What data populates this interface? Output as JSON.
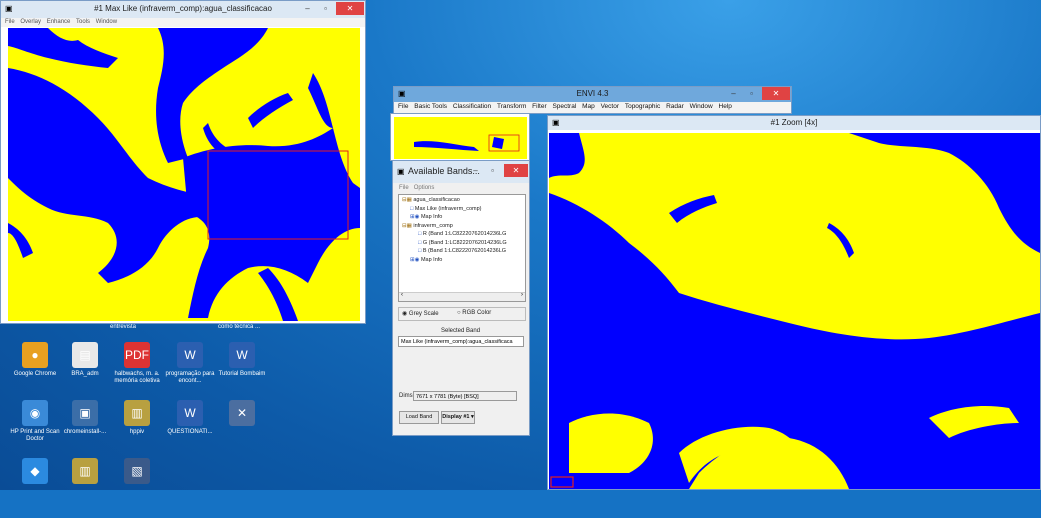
{
  "desktop": {
    "icons": [
      {
        "name": "chrome",
        "label": "Google Chrome",
        "color": "#e8a020",
        "glyph": "●"
      },
      {
        "name": "bra-adm",
        "label": "BRA_adm",
        "color": "#e8e8e8",
        "glyph": "▤"
      },
      {
        "name": "halbwachs",
        "label": "halbwachs, m. a. memória coletiva",
        "color": "#d33",
        "glyph": "PDF"
      },
      {
        "name": "programacao",
        "label": "programação para encont...",
        "color": "#2b5fb0",
        "glyph": "W"
      },
      {
        "name": "tutorial",
        "label": "Tutorial Bombaim",
        "color": "#2b5fb0",
        "glyph": "W"
      },
      {
        "name": "hp-print",
        "label": "HP Print and Scan Doctor",
        "color": "#3a8ad8",
        "glyph": "◉"
      },
      {
        "name": "chromeinstall",
        "label": "chromeinstall-...",
        "color": "#3b6ea8",
        "glyph": "▣"
      },
      {
        "name": "hppiv",
        "label": "hppiv",
        "color": "#b8a040",
        "glyph": "▥"
      },
      {
        "name": "questionati",
        "label": "QUESTIONATI...",
        "color": "#2b5fb0",
        "glyph": "W"
      },
      {
        "name": "row3-a",
        "label": "",
        "color": "#4b6ea0",
        "glyph": "✕"
      },
      {
        "name": "row3-b",
        "label": "",
        "color": "#2b8ae0",
        "glyph": "◆"
      },
      {
        "name": "row3-c",
        "label": "",
        "color": "#b8a040",
        "glyph": "▥"
      },
      {
        "name": "row3-d",
        "label": "",
        "color": "#3a5a8a",
        "glyph": "▧"
      }
    ],
    "captions": [
      "entrevista",
      "como técnica ..."
    ]
  },
  "image_window": {
    "title": "#1 Max Like (infraverm_comp):agua_classificacao",
    "menu": [
      "File",
      "Overlay",
      "Enhance",
      "Tools",
      "Window"
    ]
  },
  "envi_main": {
    "title": "ENVI 4.3",
    "menu": [
      "File",
      "Basic Tools",
      "Classification",
      "Transform",
      "Filter",
      "Spectral",
      "Map",
      "Vector",
      "Topographic",
      "Radar",
      "Window",
      "Help"
    ]
  },
  "bands_window": {
    "title": "Available Bands...",
    "menu": [
      "File",
      "Options"
    ],
    "tree": [
      {
        "text": "agua_classificacao",
        "indent": 0
      },
      {
        "text": "Max Like (infraverm_comp)",
        "indent": 1
      },
      {
        "text": "Map Info",
        "indent": 1
      },
      {
        "text": "infraverm_comp",
        "indent": 0
      },
      {
        "text": "R (Band 1:LC82220762014236LG",
        "indent": 2
      },
      {
        "text": "G (Band 1:LC82220762014236LG",
        "indent": 2
      },
      {
        "text": "B (Band 1:LC82220762014236LG",
        "indent": 2
      },
      {
        "text": "Map Info",
        "indent": 1
      }
    ],
    "radio_grey": "Grey Scale",
    "radio_rgb": "RGB Color",
    "selected_band_label": "Selected Band",
    "selected_band_value": "Max Like (infraverm_comp):agua_classificaca",
    "dims_label": "Dims",
    "dims_value": "7671 x 7781 (Byte) [BSQ]",
    "load_band": "Load Band",
    "display": "Display #1 ▾"
  },
  "zoom_window": {
    "title": "#1 Zoom [4x]"
  },
  "colors": {
    "water": "#0000ff",
    "land": "#ffff00",
    "roi": "#e02020"
  }
}
